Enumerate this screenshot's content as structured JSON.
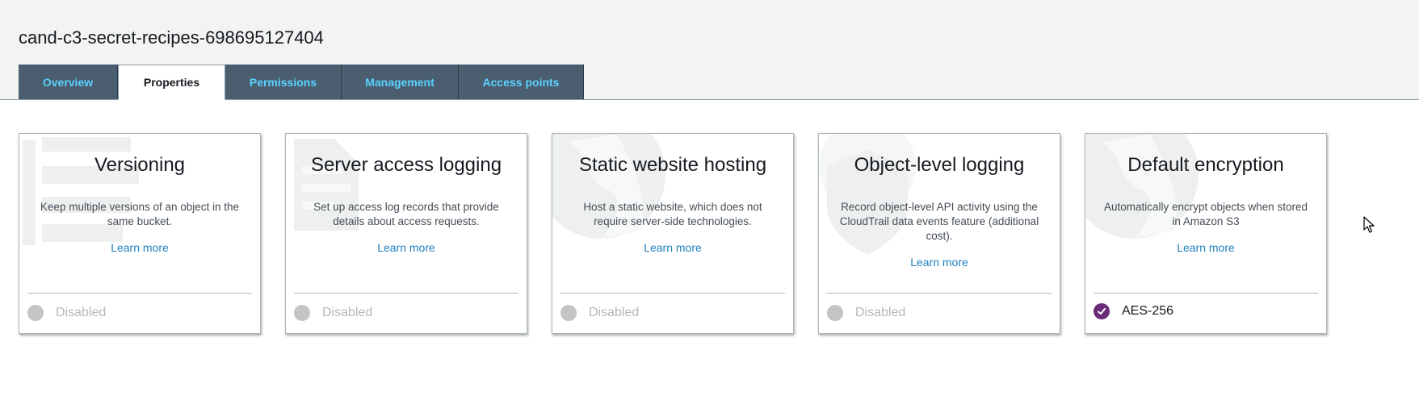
{
  "bucket": {
    "name": "cand-c3-secret-recipes-698695127404"
  },
  "tabs": [
    {
      "label": "Overview"
    },
    {
      "label": "Properties"
    },
    {
      "label": "Permissions"
    },
    {
      "label": "Management"
    },
    {
      "label": "Access points"
    }
  ],
  "active_tab": "Properties",
  "cards": [
    {
      "title": "Versioning",
      "description": "Keep multiple versions of an object in the same bucket.",
      "learn_more": "Learn more",
      "status": "Disabled",
      "icon": "versioning-icon"
    },
    {
      "title": "Server access logging",
      "description": "Set up access log records that provide details about access requests.",
      "learn_more": "Learn more",
      "status": "Disabled",
      "icon": "logging-icon"
    },
    {
      "title": "Static website hosting",
      "description": "Host a static website, which does not require server-side technologies.",
      "learn_more": "Learn more",
      "status": "Disabled",
      "icon": "globe-icon"
    },
    {
      "title": "Object-level logging",
      "description": "Record object-level API activity using the CloudTrail data events feature (additional cost).",
      "learn_more": "Learn more",
      "status": "Disabled",
      "icon": "shield-icon"
    },
    {
      "title": "Default encryption",
      "description": "Automatically encrypt objects when stored in Amazon S3",
      "learn_more": "Learn more",
      "status": "AES-256",
      "icon": "globe-icon"
    }
  ],
  "colors": {
    "tab_bg": "#4a5e70",
    "tab_text": "#5ad1ff",
    "link": "#1f7fbf",
    "enabled": "#6b2c7a",
    "disabled": "#c4c4c4"
  }
}
